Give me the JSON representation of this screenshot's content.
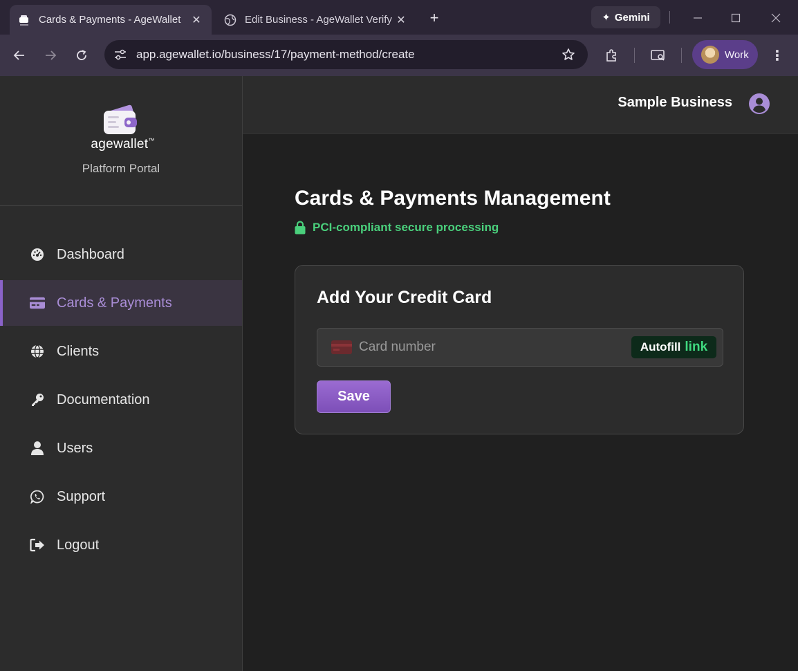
{
  "browser": {
    "tabs": [
      {
        "title": "Cards & Payments - AgeWallet",
        "active": true
      },
      {
        "title": "Edit Business - AgeWallet Verify",
        "active": false
      }
    ],
    "gemini_label": "Gemini",
    "url": "app.agewallet.io/business/17/payment-method/create",
    "profile_label": "Work"
  },
  "sidebar": {
    "logo_text": "agewallet",
    "logo_tm": "™",
    "portal_label": "Platform Portal",
    "items": [
      {
        "label": "Dashboard",
        "icon": "dashboard-gauge-icon",
        "active": false
      },
      {
        "label": "Cards & Payments",
        "icon": "credit-card-icon",
        "active": true
      },
      {
        "label": "Clients",
        "icon": "globe-icon",
        "active": false
      },
      {
        "label": "Documentation",
        "icon": "key-icon",
        "active": false
      },
      {
        "label": "Users",
        "icon": "user-icon",
        "active": false
      },
      {
        "label": "Support",
        "icon": "whatsapp-icon",
        "active": false
      },
      {
        "label": "Logout",
        "icon": "logout-icon",
        "active": false
      }
    ]
  },
  "header": {
    "business_name": "Sample Business"
  },
  "main": {
    "page_title": "Cards & Payments Management",
    "secure_note": "PCI-compliant secure processing",
    "card": {
      "title": "Add Your Credit Card",
      "card_number_placeholder": "Card number",
      "autofill_label": "Autofill",
      "autofill_brand": "link",
      "save_label": "Save"
    }
  },
  "colors": {
    "accent": "#8a62c9",
    "secure_green": "#4ad07c",
    "link_green": "#3fd97f"
  }
}
